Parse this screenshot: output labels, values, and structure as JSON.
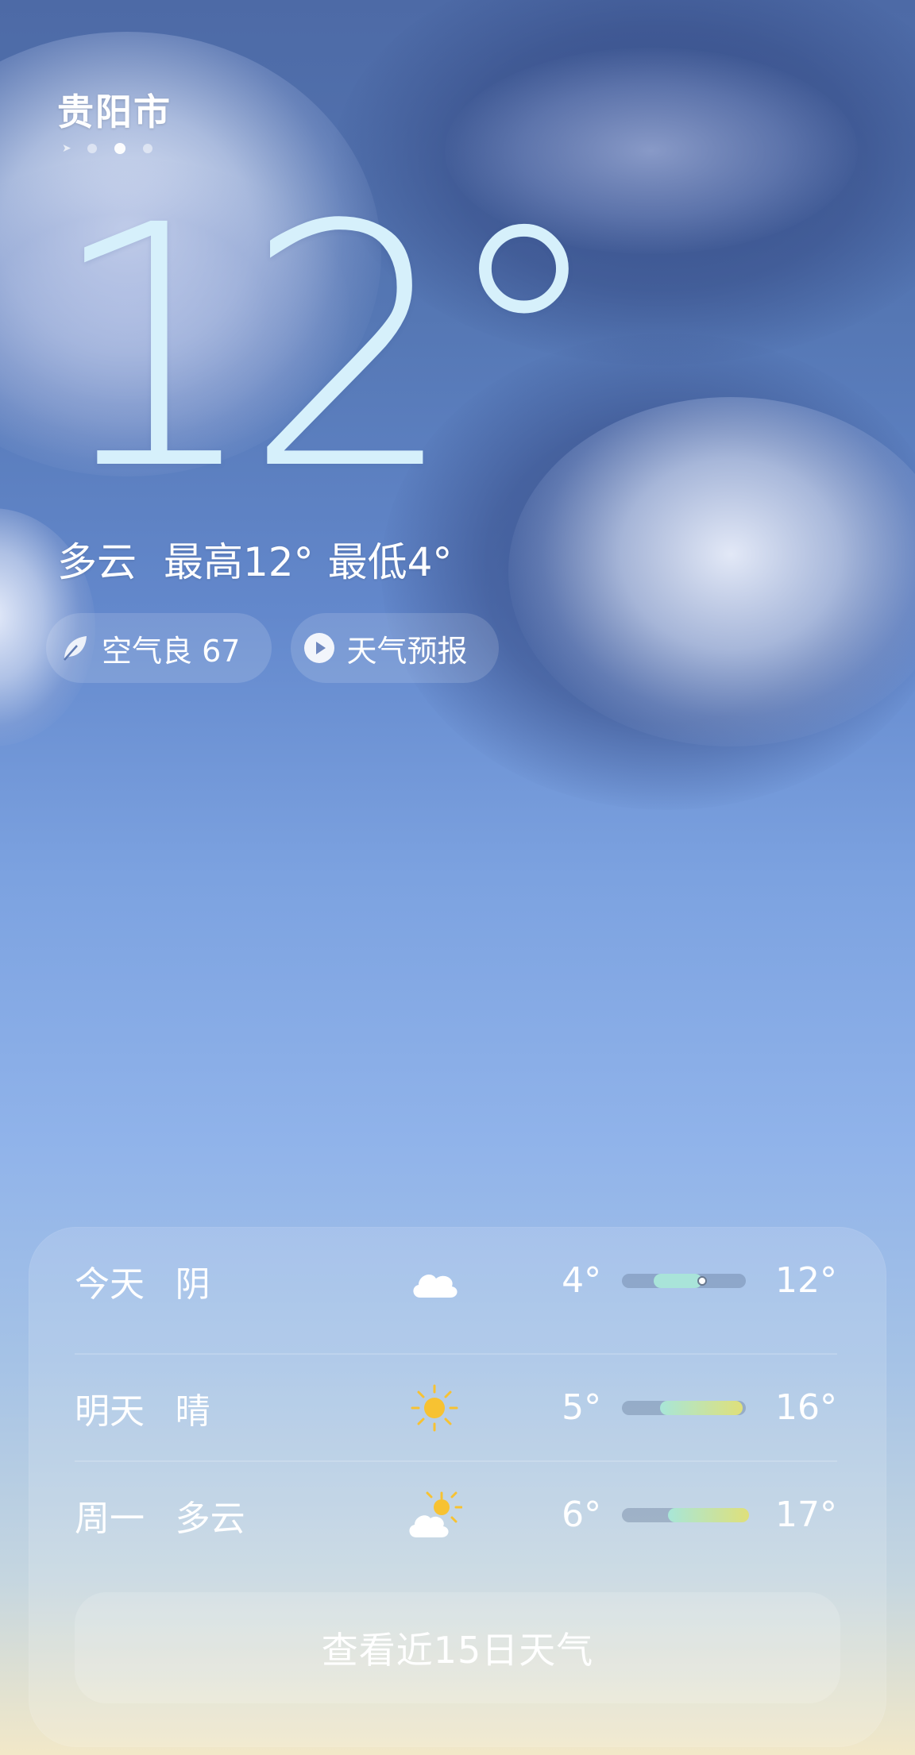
{
  "location": {
    "city": "贵阳市"
  },
  "pager": {
    "count": 4,
    "active_index": 2
  },
  "current": {
    "temperature": "12",
    "degree_symbol": "°",
    "condition": "多云",
    "high_label": "最高12°",
    "low_label": "最低4°"
  },
  "chips": {
    "air_quality": "空气良 67",
    "forecast_video": "天气预报"
  },
  "forecast": {
    "days": [
      {
        "day": "今天",
        "condition": "阴",
        "icon": "cloud-icon",
        "low": "4°",
        "high": "12°",
        "range_start": 0.25,
        "range_end": 0.63,
        "current_pos": 0.63
      },
      {
        "day": "明天",
        "condition": "晴",
        "icon": "sun-icon",
        "low": "5°",
        "high": "16°",
        "range_start": 0.3,
        "range_end": 0.95
      },
      {
        "day": "周一",
        "condition": "多云",
        "icon": "partly-cloudy-icon",
        "low": "6°",
        "high": "17°",
        "range_start": 0.36,
        "range_end": 1.0
      }
    ],
    "view_15_day": "查看近15日天气"
  },
  "colors": {
    "temp_text": "#d6f0fb",
    "sun_yellow": "#f7c232",
    "bar_today": "#a9e4d9",
    "bar_gradient_start": "#a8e6d8",
    "bar_gradient_end": "#dfe07a"
  }
}
